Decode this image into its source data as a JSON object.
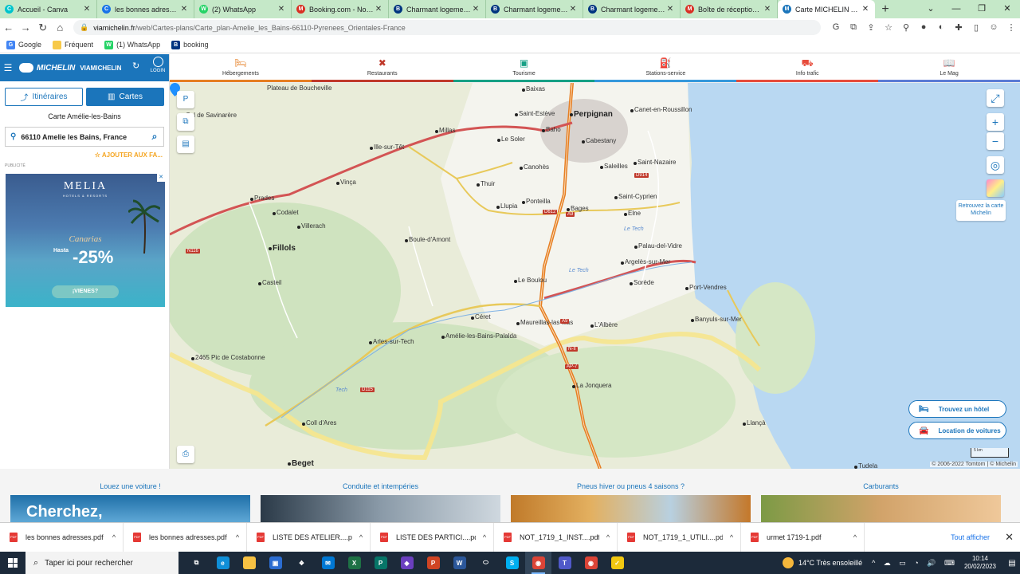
{
  "browser": {
    "tabs": [
      {
        "title": "Accueil - Canva",
        "color": "#00c4cc",
        "glyph": "C"
      },
      {
        "title": "les bonnes adresses -",
        "color": "#1a73e8",
        "glyph": "C"
      },
      {
        "title": "(2) WhatsApp",
        "color": "#25d366",
        "glyph": "W"
      },
      {
        "title": "Booking.com - Nouve",
        "color": "#d93025",
        "glyph": "M"
      },
      {
        "title": "Charmant logement a",
        "color": "#003580",
        "glyph": "B"
      },
      {
        "title": "Charmant logement a",
        "color": "#003580",
        "glyph": "B"
      },
      {
        "title": "Charmant logement a",
        "color": "#003580",
        "glyph": "B"
      },
      {
        "title": "Boîte de réception - j",
        "color": "#d93025",
        "glyph": "M"
      },
      {
        "title": "Carte MICHELIN Amé",
        "color": "#1b75bb",
        "glyph": "M"
      }
    ],
    "active_tab_index": 8,
    "url_host": "viamichelin.fr",
    "url_path": "/web/Cartes-plans/Carte_plan-Amelie_les_Bains-66110-Pyrenees_Orientales-France",
    "bookmarks": [
      {
        "label": "Google",
        "color": "#4285f4",
        "glyph": "G"
      },
      {
        "label": "Fréquent",
        "color": "#f7c948",
        "glyph": ""
      },
      {
        "label": "(1) WhatsApp",
        "color": "#25d366",
        "glyph": "W"
      },
      {
        "label": "booking",
        "color": "#003580",
        "glyph": "B"
      }
    ]
  },
  "michelin": {
    "brand": "MICHELIN",
    "brand_sub": "VIAMICHELIN",
    "login_label": "LOGIN",
    "btn_itineraires": "Itinéraires",
    "btn_cartes": "Cartes",
    "carte_title": "Carte Amélie-les-Bains",
    "search_value": "66110 Amelie les Bains, France",
    "add_fav": "AJOUTER AUX FA...",
    "pub_label": "PUBLICITÉ",
    "ad": {
      "brand": "MELIA",
      "sub": "HOTELS & RESORTS",
      "place": "Canarias",
      "hasta": "Hasta",
      "discount": "-25%",
      "cta": "¡VIENES?"
    }
  },
  "categories": [
    {
      "label": "Hébergements",
      "icon": "bed-icon",
      "glyph": "🛏",
      "color": "#e67e22"
    },
    {
      "label": "Restaurants",
      "icon": "cutlery-icon",
      "glyph": "✖",
      "color": "#c0392b"
    },
    {
      "label": "Tourisme",
      "icon": "tourism-icon",
      "glyph": "▣",
      "color": "#16a085"
    },
    {
      "label": "Stations-service",
      "icon": "fuel-icon",
      "glyph": "⛽",
      "color": "#3498db"
    },
    {
      "label": "Info trafic",
      "icon": "traffic-icon",
      "glyph": "⛟",
      "color": "#e74c3c"
    },
    {
      "label": "Le Mag",
      "icon": "book-icon",
      "glyph": "📖",
      "color": "#5b7bd5"
    }
  ],
  "map": {
    "places": [
      {
        "name": "Perpignan",
        "big": true
      },
      {
        "name": "Saint-Estève"
      },
      {
        "name": "Baixas"
      },
      {
        "name": "Baho"
      },
      {
        "name": "Millas"
      },
      {
        "name": "Le Soler"
      },
      {
        "name": "Cabestany"
      },
      {
        "name": "Canet-en-Roussillon"
      },
      {
        "name": "Ille-sur-Têt"
      },
      {
        "name": "Canohès"
      },
      {
        "name": "Saleilles"
      },
      {
        "name": "Saint-Nazaire"
      },
      {
        "name": "Thuir"
      },
      {
        "name": "Vinça"
      },
      {
        "name": "Ponteilla"
      },
      {
        "name": "Llupia"
      },
      {
        "name": "Bages"
      },
      {
        "name": "Saint-Cyprien"
      },
      {
        "name": "Elne"
      },
      {
        "name": "Prades"
      },
      {
        "name": "Codalet"
      },
      {
        "name": "Villerach"
      },
      {
        "name": "Boule-d'Amont"
      },
      {
        "name": "Palau-del-Vidre"
      },
      {
        "name": "Argelès-sur-Mer"
      },
      {
        "name": "Fillols",
        "big": true
      },
      {
        "name": "Casteil"
      },
      {
        "name": "Le Boulou"
      },
      {
        "name": "Sorède"
      },
      {
        "name": "Port-Vendres"
      },
      {
        "name": "Céret"
      },
      {
        "name": "Maureillas-las-Illas"
      },
      {
        "name": "L'Albère"
      },
      {
        "name": "Banyuls-sur-Mer"
      },
      {
        "name": "Arles-sur-Tech"
      },
      {
        "name": "Amélie-les-Bains-Palalda"
      },
      {
        "name": "2465 Pic de Costabonne"
      },
      {
        "name": "La Jonquera"
      },
      {
        "name": "Coll d'Ares"
      },
      {
        "name": "Llançà"
      },
      {
        "name": "Beget",
        "big": true
      },
      {
        "name": "Tudela"
      },
      {
        "name": "Col de Savinarère"
      },
      {
        "name": "Plateau de Boucheville"
      }
    ],
    "roads": [
      "A9",
      "N116",
      "D612",
      "D115",
      "N-II",
      "AP-7",
      "A9",
      "D914"
    ],
    "rivers": [
      "Le Tech",
      "Le Tech",
      "Tech"
    ],
    "retrouvez": "Retrouvez la carte Michelin",
    "btn_hotel": "Trouvez un hôtel",
    "btn_car": "Location de voitures",
    "scale": "5 km",
    "copyright": "© 2006-2022 Tomtom | © Michelin"
  },
  "promos": [
    {
      "title": "Louez une voiture !",
      "overlay": "Cherchez,"
    },
    {
      "title": "Conduite et intempéries",
      "overlay": ""
    },
    {
      "title": "Pneus hiver ou pneus 4 saisons ?",
      "overlay": ""
    },
    {
      "title": "Carburants",
      "overlay": ""
    }
  ],
  "downloads": {
    "files": [
      "les bonnes adresses.pdf",
      "les bonnes adresses.pdf",
      "LISTE DES ATELIER....pdf",
      "LISTE DES PARTICI....pdf",
      "NOT_1719_1_INST....pdf",
      "NOT_1719_1_UTILI....pdf",
      "urmet 1719-1.pdf"
    ],
    "show_all": "Tout afficher"
  },
  "taskbar": {
    "search_placeholder": "Taper ici pour rechercher",
    "apps": [
      {
        "name": "task-view",
        "color": "#1c2a3a",
        "glyph": "⧉"
      },
      {
        "name": "edge",
        "color": "#0f8fd8",
        "glyph": "e"
      },
      {
        "name": "file-explorer",
        "color": "#f6c143",
        "glyph": ""
      },
      {
        "name": "store",
        "color": "#2b6cd1",
        "glyph": "▣"
      },
      {
        "name": "dropbox",
        "color": "#1c2a3a",
        "glyph": "❖"
      },
      {
        "name": "mail",
        "color": "#0078d4",
        "glyph": "✉"
      },
      {
        "name": "excel",
        "color": "#1e7145",
        "glyph": "X"
      },
      {
        "name": "publisher",
        "color": "#077568",
        "glyph": "P"
      },
      {
        "name": "visual-studio",
        "color": "#6a3fbf",
        "glyph": "◆"
      },
      {
        "name": "powerpoint",
        "color": "#d04423",
        "glyph": "P"
      },
      {
        "name": "word",
        "color": "#2b579a",
        "glyph": "W"
      },
      {
        "name": "teams-meet",
        "color": "#1c2a3a",
        "glyph": "⬭"
      },
      {
        "name": "skype",
        "color": "#00aff0",
        "glyph": "S"
      },
      {
        "name": "chrome-active",
        "color": "#db4437",
        "glyph": "◉",
        "active": true
      },
      {
        "name": "teams",
        "color": "#5059c9",
        "glyph": "T"
      },
      {
        "name": "chrome",
        "color": "#db4437",
        "glyph": "◉"
      },
      {
        "name": "norton",
        "color": "#f2c811",
        "glyph": "✓"
      }
    ],
    "weather": "14°C  Très ensoleillé",
    "time": "10:14",
    "date": "20/02/2023"
  }
}
